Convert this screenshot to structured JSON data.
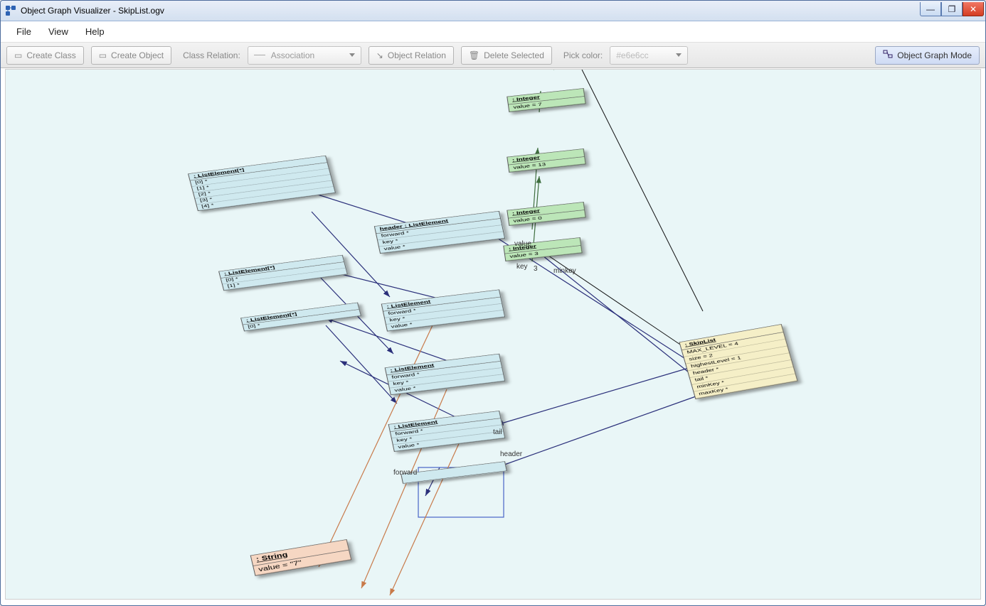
{
  "window": {
    "title": "Object Graph Visualizer - SkipList.ogv"
  },
  "menu": [
    "File",
    "View",
    "Help"
  ],
  "toolbar": {
    "create_class_label": "Create Class",
    "create_object_label": "Create Object",
    "class_relation_label": "Class Relation:",
    "relation_combo_value": "Association",
    "object_relation_label": "Object Relation",
    "delete_selected_label": "Delete Selected",
    "pick_color_label": "Pick color:",
    "pick_color_value": "#e6e6cc",
    "mode_label": "Object Graph Mode"
  },
  "graph": {
    "objects": {
      "listElem4": {
        "title": ": ListElement[*]",
        "rows": [
          "[0] *",
          "[1] *",
          "[2] *",
          "[3] *",
          "[4] *"
        ]
      },
      "listElem2": {
        "title": ": ListElement[*]",
        "rows": [
          "[0] *",
          "[1] *"
        ]
      },
      "listElem1": {
        "title": ": ListElement[*]",
        "rows": [
          "[0] *"
        ]
      },
      "header": {
        "title": "header : ListElement",
        "rows": [
          "forward *",
          "key *",
          "value *"
        ]
      },
      "le_a": {
        "title": ": ListElement",
        "rows": [
          "forward *",
          "key *",
          "value *"
        ]
      },
      "le_b": {
        "title": ": ListElement",
        "rows": [
          "forward *",
          "key *",
          "value *"
        ]
      },
      "le_c": {
        "title": ": ListElement",
        "rows": [
          "forward *",
          "key *",
          "value *"
        ]
      },
      "int0": {
        "title": ": Integer",
        "rows": [
          "value = 0"
        ]
      },
      "int7": {
        "title": ": Integer",
        "rows": [
          "value = 7"
        ]
      },
      "int13": {
        "title": ": Integer",
        "rows": [
          "value = 13"
        ]
      },
      "int3": {
        "title": ": Integer",
        "rows": [
          "value = 3"
        ]
      },
      "skiplist": {
        "title": ": SkipList",
        "rows": [
          "MAX_LEVEL = 4",
          "size = 2",
          "highestLevel = 1",
          "header *",
          "tail *",
          "minKey *",
          "maxKey *"
        ]
      },
      "string": {
        "title": ": String",
        "rows": [
          "value = \"7\""
        ]
      }
    },
    "edge_labels": {
      "value": "value",
      "key": "key",
      "three": "3",
      "minkey": "minkey",
      "tail": "tail",
      "headerlbl": "header",
      "forward": "forward"
    }
  }
}
